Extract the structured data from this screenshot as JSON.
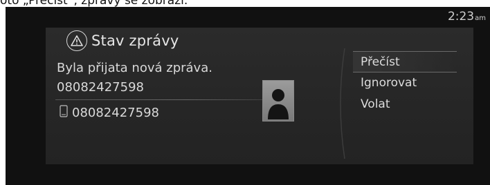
{
  "caption": "oto „Přečíst“, zprávy se zobrazí.",
  "clock": {
    "time": "2:23",
    "ampm": "am"
  },
  "dialog": {
    "title": "Stav zprávy",
    "message": "Byla přijata nová zpráva.",
    "sender_number": "08082427598",
    "phone_number": "08082427598"
  },
  "menu": {
    "items": [
      {
        "label": "Přečíst",
        "selected": true
      },
      {
        "label": "Ignorovat",
        "selected": false
      },
      {
        "label": "Volat",
        "selected": false
      }
    ]
  },
  "icons": {
    "warning": "warning-triangle-icon",
    "phone": "mobile-phone-icon",
    "avatar": "contact-avatar-icon"
  },
  "colors": {
    "screen_bg": "#111111",
    "dialog_bg": "#2b2b2b",
    "text": "#dcdcdc",
    "avatar_bg": "#8a8a8a"
  }
}
